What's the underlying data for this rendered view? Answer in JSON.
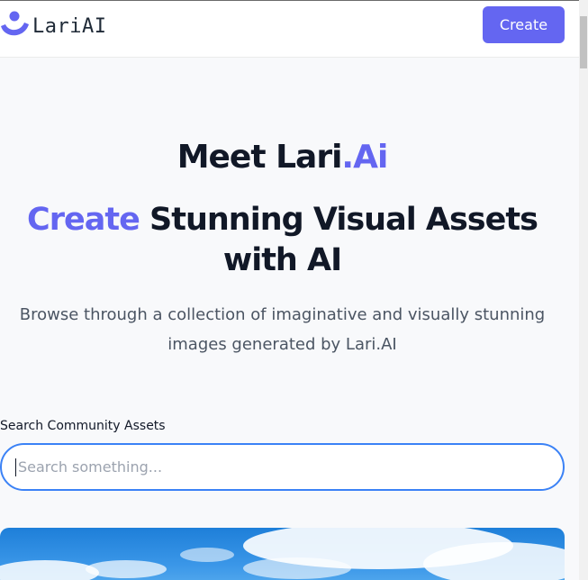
{
  "header": {
    "logo_text": "LariAI",
    "create_label": "Create",
    "brand_color": "#6466f1"
  },
  "hero": {
    "title_part1": "Meet Lari",
    "title_part2": ".Ai",
    "headline_accent": "Create",
    "headline_rest": " Stunning Visual Assets with AI",
    "subtitle": "Browse through a collection of imaginative and visually stunning images generated by Lari.AI"
  },
  "search": {
    "label": "Search Community Assets",
    "placeholder": "Search something...",
    "value": ""
  },
  "icons": {
    "logo": "lariai-logo-icon"
  }
}
